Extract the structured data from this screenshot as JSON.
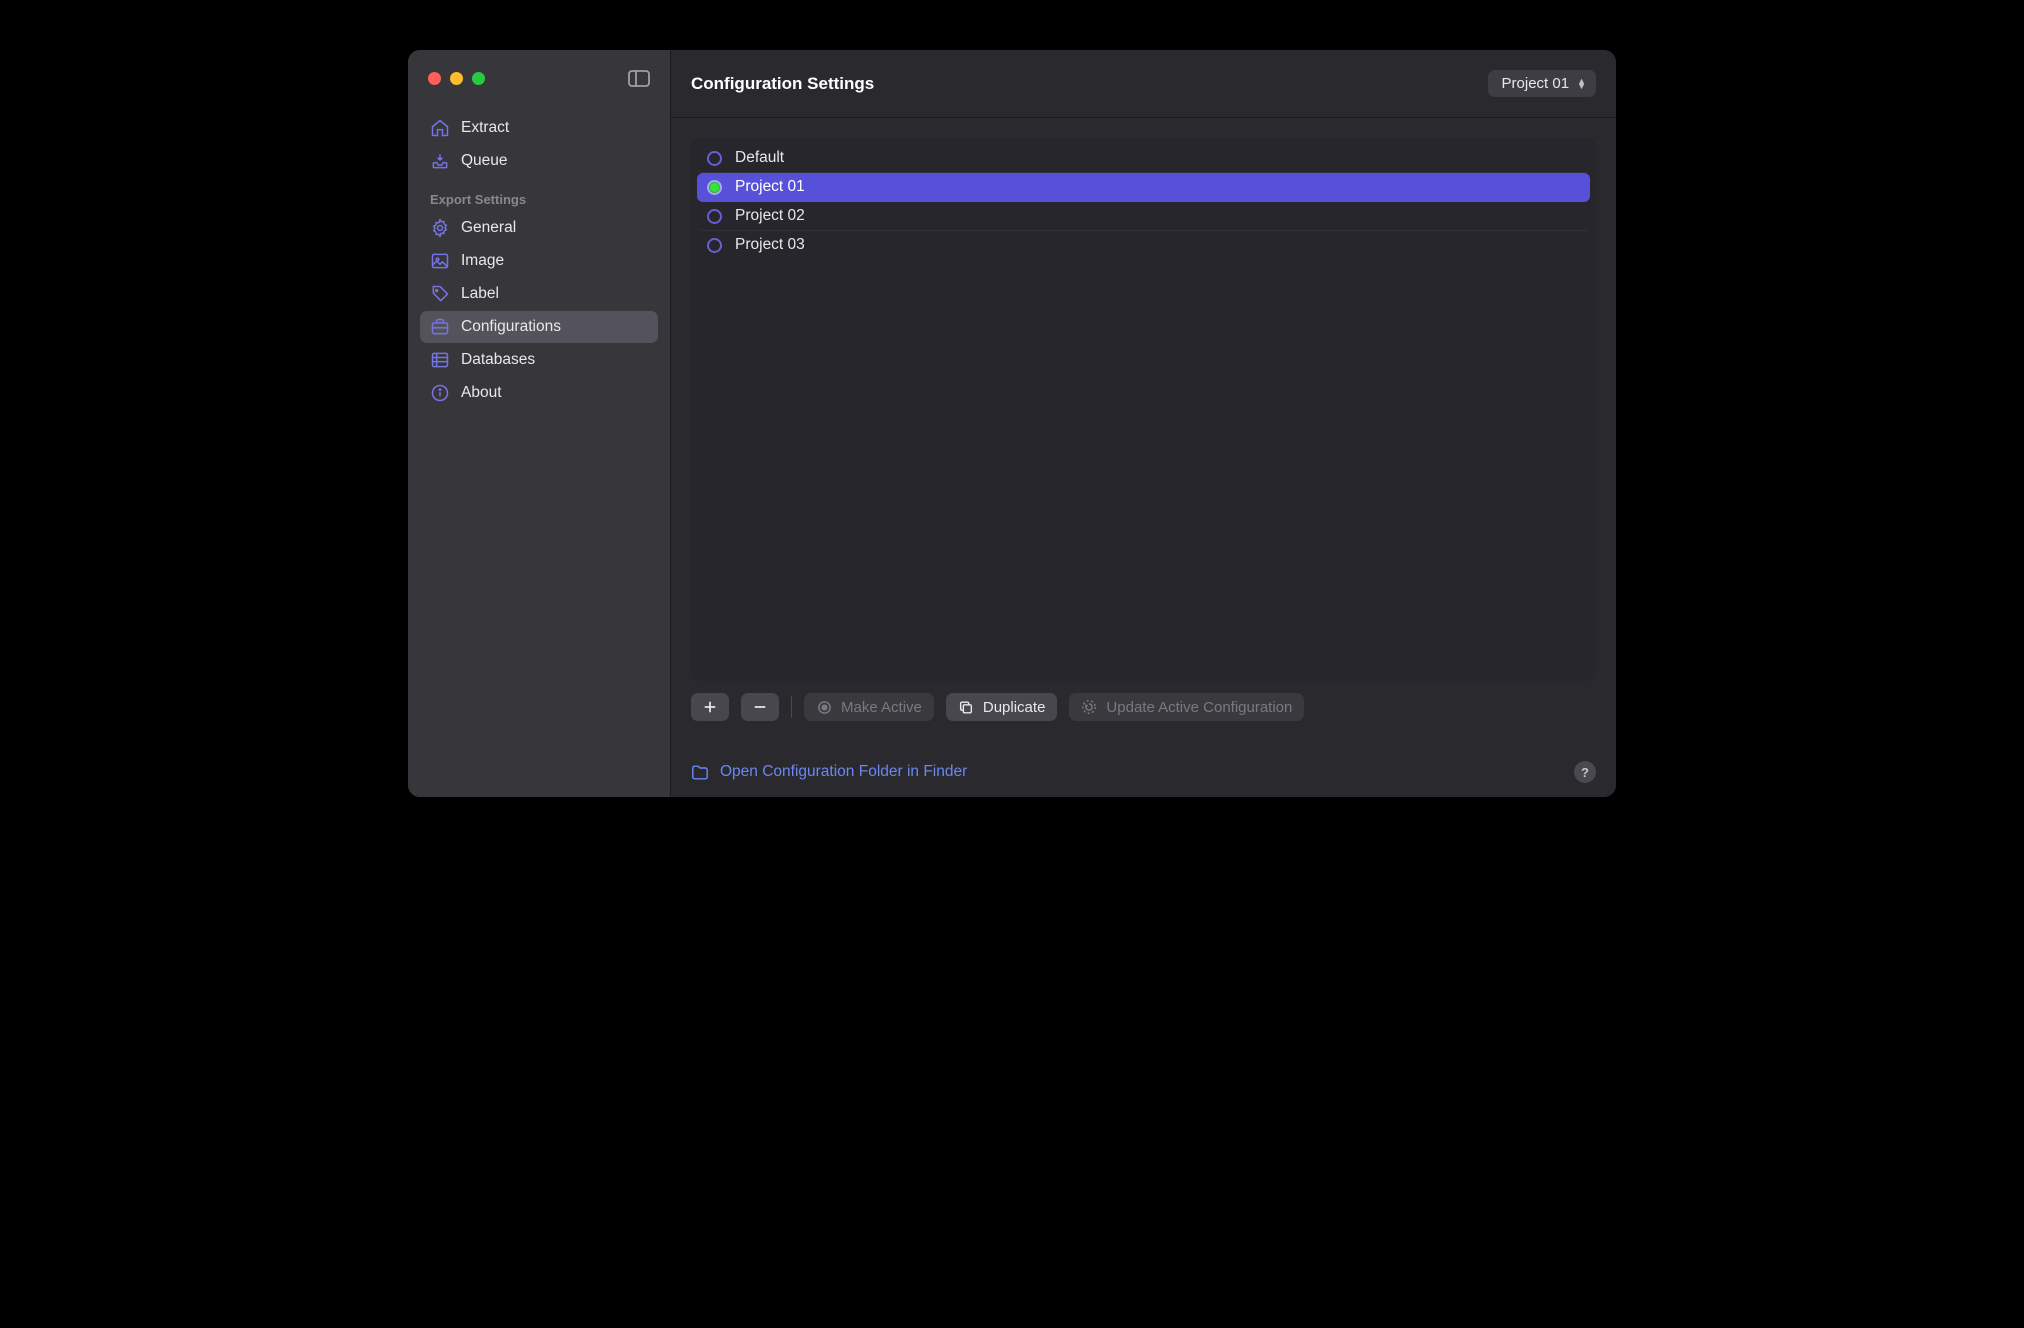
{
  "header": {
    "title": "Configuration Settings",
    "project_selected": "Project 01"
  },
  "sidebar": {
    "top_items": [
      {
        "label": "Extract",
        "icon": "home"
      },
      {
        "label": "Queue",
        "icon": "tray"
      }
    ],
    "section_header": "Export Settings",
    "settings_items": [
      {
        "label": "General",
        "icon": "gear"
      },
      {
        "label": "Image",
        "icon": "image"
      },
      {
        "label": "Label",
        "icon": "tag"
      },
      {
        "label": "Configurations",
        "icon": "briefcase",
        "selected": true
      },
      {
        "label": "Databases",
        "icon": "database"
      },
      {
        "label": "About",
        "icon": "info"
      }
    ]
  },
  "configurations": [
    {
      "name": "Default",
      "active": false,
      "selected": false
    },
    {
      "name": "Project 01",
      "active": true,
      "selected": true
    },
    {
      "name": "Project 02",
      "active": false,
      "selected": false
    },
    {
      "name": "Project 03",
      "active": false,
      "selected": false
    }
  ],
  "toolbar": {
    "make_active": "Make Active",
    "duplicate": "Duplicate",
    "update": "Update Active Configuration"
  },
  "footer": {
    "finder_link": "Open Configuration Folder in Finder"
  }
}
